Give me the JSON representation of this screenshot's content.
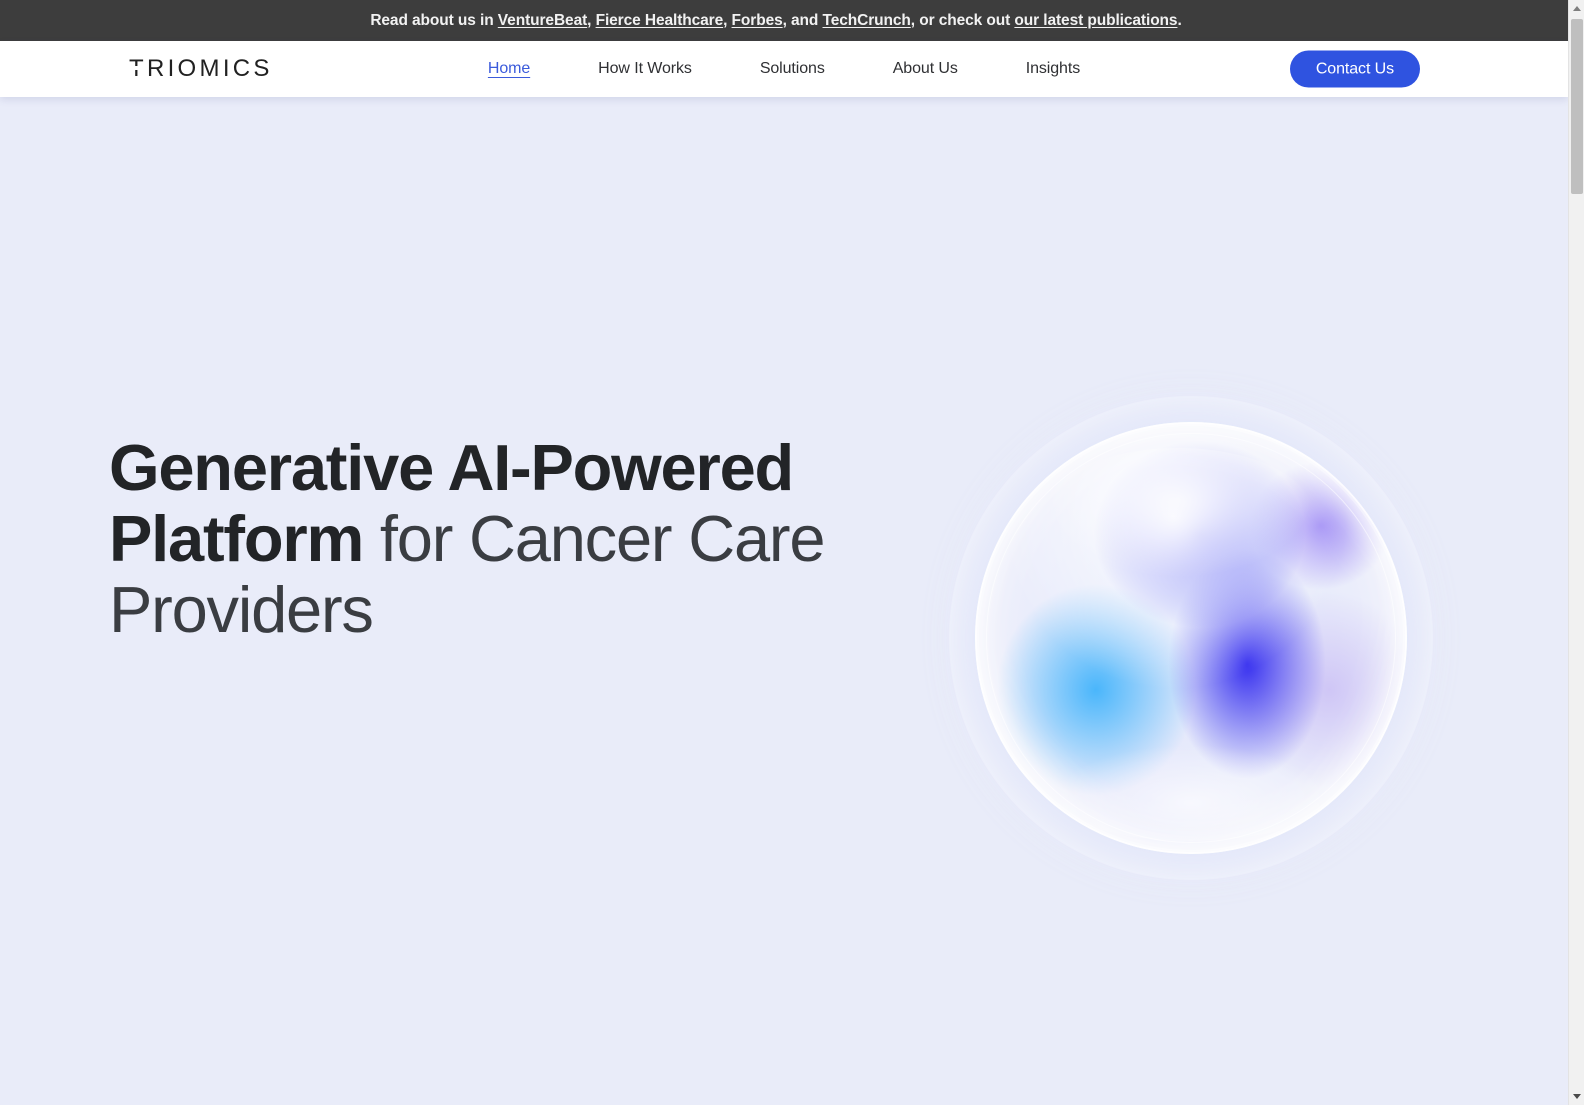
{
  "announcement": {
    "prefix": "Read about us in ",
    "links": [
      {
        "label": "VentureBeat",
        "after": ", "
      },
      {
        "label": "Fierce Healthcare",
        "after": ", "
      },
      {
        "label": "Forbes",
        "after": ", and "
      },
      {
        "label": "TechCrunch",
        "after": ", or check out "
      },
      {
        "label": "our latest publications",
        "after": "."
      }
    ],
    "full_text": "Read about us in VentureBeat, Fierce Healthcare, Forbes, and TechCrunch, or check out our latest publications.",
    "background_color": "#3d3d3d",
    "text_color": "#f2f2f2"
  },
  "nav": {
    "logo": "TRIOMICS",
    "links": [
      {
        "label": "Home",
        "active": true
      },
      {
        "label": "How It Works",
        "active": false
      },
      {
        "label": "Solutions",
        "active": false
      },
      {
        "label": "About Us",
        "active": false
      },
      {
        "label": "Insights",
        "active": false
      }
    ],
    "cta_label": "Contact Us",
    "cta_color": "#2f53e0",
    "active_link_color": "#3b5bdb",
    "background_color": "#ffffff"
  },
  "hero": {
    "headline_strong": "Generative AI-Powered Platform",
    "headline_light": " for Cancer Care Providers",
    "background_color": "#e9ecf9",
    "headline_color": "#26282c",
    "graphic": "gradient-sphere"
  },
  "scrollbar": {
    "up_arrow": "▲",
    "down_arrow": "▼",
    "track_color": "#f1f1f1",
    "thumb_color": "#bfbfbf"
  }
}
